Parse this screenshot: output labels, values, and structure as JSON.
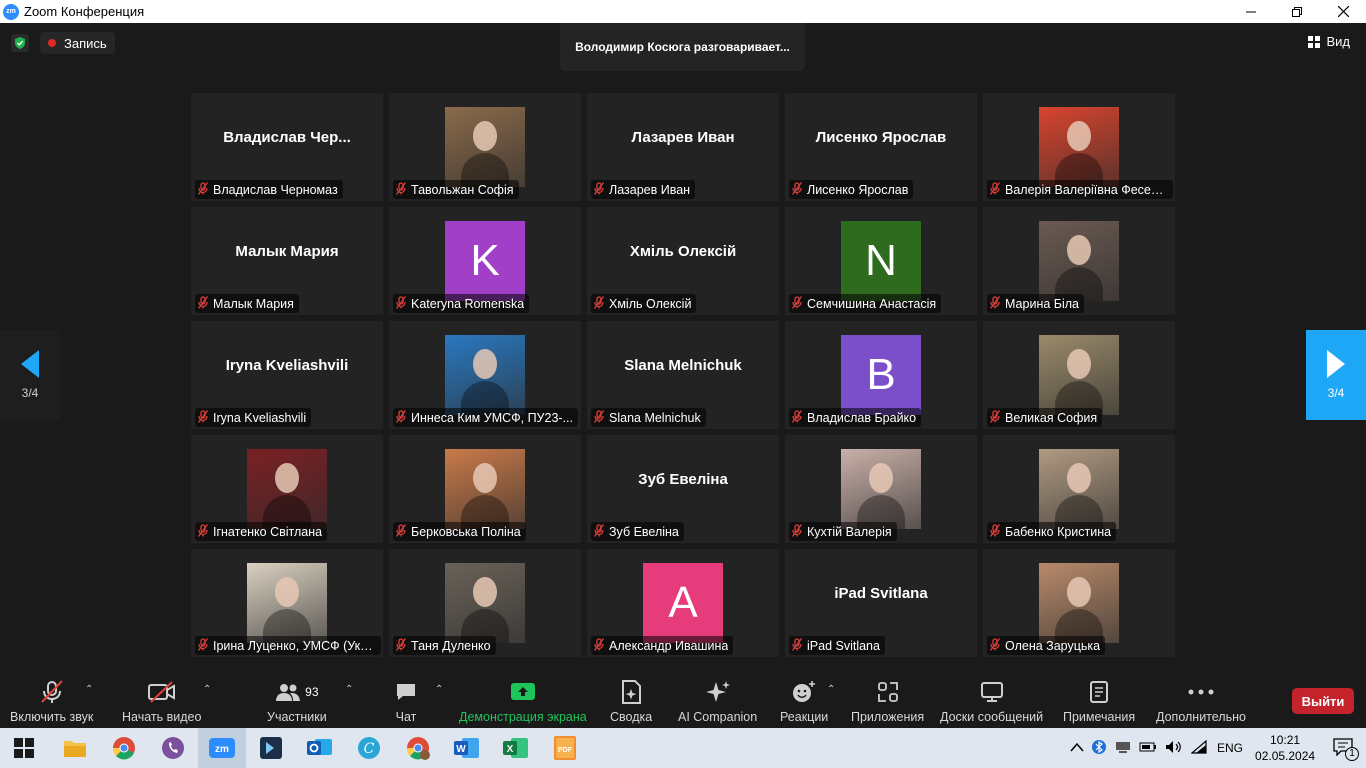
{
  "window": {
    "title": "Zoom Конференция",
    "icon_text": "zm",
    "controls": [
      "minimize-icon",
      "restore-icon",
      "close-icon"
    ]
  },
  "top": {
    "record_label": "Запись",
    "speaker_text": "Володимир Косюга разговаривает...",
    "view_label": "Вид"
  },
  "tiles": [
    {
      "big": "Владислав  Чер...",
      "label": "Владислав Черномаз",
      "kind": "name"
    },
    {
      "label": "Тавольжан Софія",
      "kind": "photo",
      "photo": "#8a6a4a"
    },
    {
      "big": "Лазарев Иван",
      "label": "Лазарев Иван",
      "kind": "name"
    },
    {
      "big": "Лисенко Ярослав",
      "label": "Лисенко Ярослав",
      "kind": "name"
    },
    {
      "label": "Валерія Валеріївна Фесенко",
      "kind": "photo",
      "photo": "#d8442e"
    },
    {
      "big": "Малык Мария",
      "label": "Малык Мария",
      "kind": "name"
    },
    {
      "letter": "K",
      "color": "#a23fc8",
      "label": "Kateryna Romenska",
      "kind": "letter"
    },
    {
      "big": "Хміль Олексій",
      "label": "Хміль Олексій",
      "kind": "name"
    },
    {
      "letter": "N",
      "color": "#2e6b1f",
      "label": "Семчишина Анастасія",
      "kind": "letter"
    },
    {
      "label": "Марина Біла",
      "kind": "photo",
      "photo": "#6b5a52"
    },
    {
      "big": "Iryna Kveliashvili",
      "label": "Iryna Kveliashvili",
      "kind": "name"
    },
    {
      "label": "Иннеса Ким УМСФ, ПУ23-...",
      "kind": "photo",
      "photo": "#2a78c0"
    },
    {
      "big": "Slana Melnichuk",
      "label": "Slana Melnichuk",
      "kind": "name"
    },
    {
      "letter": "B",
      "color": "#7a4fc9",
      "label": "Владислав Брайко",
      "kind": "letter"
    },
    {
      "label": "Великая София",
      "kind": "photo",
      "photo": "#9a8a6a"
    },
    {
      "label": "Ігнатенко Світлана",
      "kind": "photo",
      "photo": "#7a2024"
    },
    {
      "label": "Берковська Поліна",
      "kind": "photo",
      "photo": "#c97a4a"
    },
    {
      "big": "Зуб Евеліна",
      "label": "Зуб Евеліна",
      "kind": "name"
    },
    {
      "label": "Кухтій Валерія",
      "kind": "photo",
      "photo": "#c9b0a8"
    },
    {
      "label": "Бабенко Кристина",
      "kind": "photo",
      "photo": "#b09a82"
    },
    {
      "label": "Ірина Луценко, УМСФ (Укр...",
      "kind": "photo",
      "photo": "#d9d0c0"
    },
    {
      "label": "Таня Дуленко",
      "kind": "photo",
      "photo": "#6a6258"
    },
    {
      "letter": "A",
      "color": "#e63c7b",
      "label": "Александр Ивашина",
      "kind": "letter"
    },
    {
      "big": "iPad Svitlana",
      "label": "iPad Svitlana",
      "kind": "name"
    },
    {
      "label": "Олена Заруцька",
      "kind": "photo",
      "photo": "#b88a6a"
    }
  ],
  "paging": {
    "left": "3/4",
    "right": "3/4"
  },
  "toolbar": {
    "unmute": "Включить звук",
    "start_video": "Начать видео",
    "participants": "Участники",
    "participants_count": "93",
    "chat": "Чат",
    "share": "Демонстрация экрана",
    "summary": "Сводка",
    "ai": "AI Companion",
    "reactions": "Реакции",
    "apps": "Приложения",
    "whiteboards": "Доски сообщений",
    "notes": "Примечания",
    "more": "Дополнительно",
    "leave": "Выйти"
  },
  "taskbar": {
    "apps": [
      "start-icon",
      "file-explorer-icon",
      "chrome-icon",
      "viber-icon",
      "zoom-icon",
      "app-icon",
      "outlook-icon",
      "canva-icon",
      "chrome-profile-icon",
      "word-icon",
      "excel-icon",
      "pdf-icon"
    ],
    "lang": "ENG",
    "time": "10:21",
    "date": "02.05.2024",
    "notif_count": "1"
  },
  "colors": {
    "accent": "#1ea7f6",
    "share_green": "#1fc45a",
    "leave_red": "#c5232b"
  }
}
